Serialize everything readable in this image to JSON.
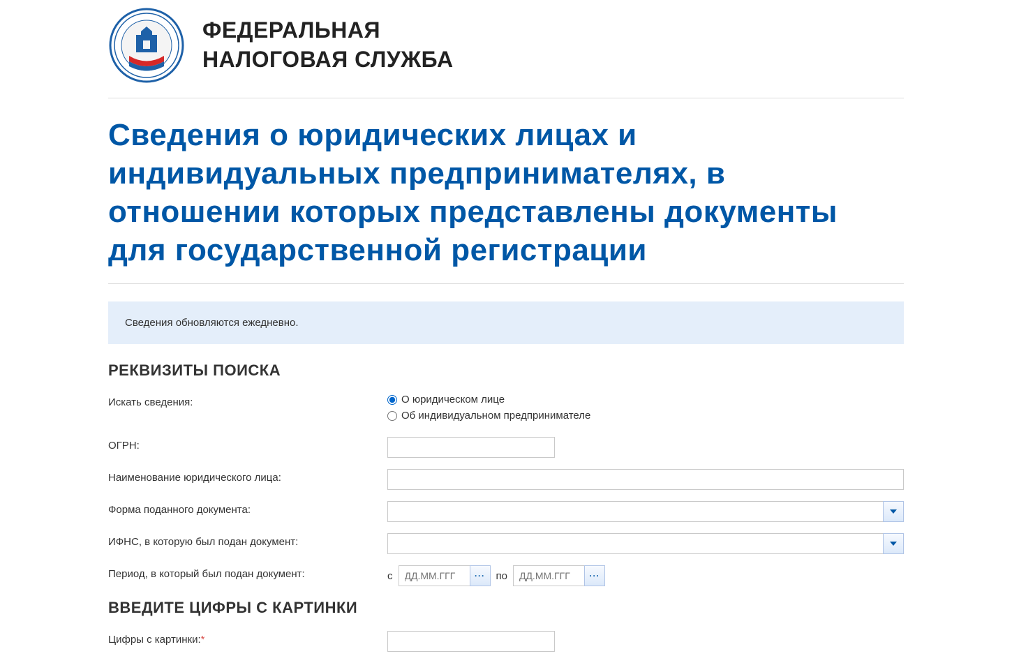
{
  "header": {
    "org_line1": "ФЕДЕРАЛЬНАЯ",
    "org_line2": "НАЛОГОВАЯ СЛУЖБА"
  },
  "page_title": "Сведения о юридических лицах и индивидуальных предпринимателях, в отношении которых представлены документы для государственной регистрации",
  "notice": "Сведения обновляются ежедневно.",
  "sections": {
    "search": "РЕКВИЗИТЫ ПОИСКА",
    "captcha": "ВВЕДИТЕ ЦИФРЫ С КАРТИНКИ"
  },
  "labels": {
    "search_for": "Искать сведения:",
    "ogrn": "ОГРН:",
    "name": "Наименование юридического лица:",
    "doc_form": "Форма поданного документа:",
    "ifns": "ИФНС, в которую был подан документ:",
    "period": "Период, в который был подан документ:",
    "captcha": "Цифры с картинки:",
    "from": "с",
    "to": "по"
  },
  "radios": {
    "legal": "О юридическом лице",
    "individual": "Об индивидуальном предпринимателе"
  },
  "placeholders": {
    "date": "ДД.ММ.ГГГ"
  },
  "req_marker": "*"
}
